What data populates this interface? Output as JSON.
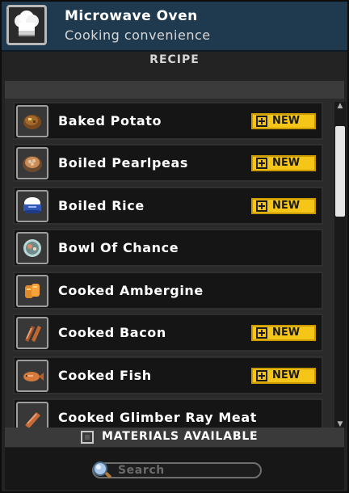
{
  "header": {
    "title": "Microwave Oven",
    "subtitle": "Cooking convenience",
    "icon": "chef-hat-icon"
  },
  "section_label": "RECIPE",
  "recipes": [
    {
      "label": "Baked Potato",
      "icon": "baked-potato-icon",
      "is_new": true,
      "badge": "NEW"
    },
    {
      "label": "Boiled Pearlpeas",
      "icon": "boiled-pearlpeas-icon",
      "is_new": true,
      "badge": "NEW"
    },
    {
      "label": "Boiled Rice",
      "icon": "boiled-rice-icon",
      "is_new": true,
      "badge": "NEW"
    },
    {
      "label": "Bowl Of Chance",
      "icon": "bowl-of-chance-icon",
      "is_new": false,
      "badge": ""
    },
    {
      "label": "Cooked Ambergine",
      "icon": "cooked-ambergine-icon",
      "is_new": false,
      "badge": ""
    },
    {
      "label": "Cooked Bacon",
      "icon": "cooked-bacon-icon",
      "is_new": true,
      "badge": "NEW"
    },
    {
      "label": "Cooked Fish",
      "icon": "cooked-fish-icon",
      "is_new": true,
      "badge": "NEW"
    },
    {
      "label": "Cooked Glimber Ray Meat",
      "icon": "cooked-glimber-ray-meat-icon",
      "is_new": false,
      "badge": ""
    }
  ],
  "materials": {
    "label": "MATERIALS AVAILABLE",
    "checked": false
  },
  "search": {
    "placeholder": "Search"
  },
  "colors": {
    "header_bg": "#1f3a4f",
    "new_badge": "#f5c518",
    "row_bg": "#151515"
  }
}
